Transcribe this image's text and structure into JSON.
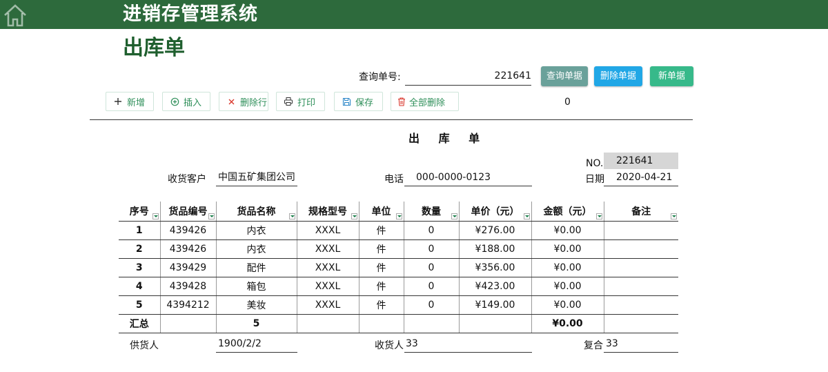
{
  "header": {
    "app_title": "进销存管理系统"
  },
  "page_title": "出库单",
  "query": {
    "label": "查询单号:",
    "value": "221641"
  },
  "actions": {
    "query": "查询单据",
    "delete_doc": "删除单据",
    "new_doc": "新单据"
  },
  "toolbar": {
    "add": "新增",
    "insert": "插入",
    "delete_row": "删除行",
    "print": "打印",
    "save": "保存",
    "delete_all": "全部删除",
    "counter": "0"
  },
  "form": {
    "title": "出 库 单",
    "no_label": "NO.",
    "no_value": "221641",
    "customer_label": "收货客户",
    "customer_value": "中国五矿集团公司",
    "phone_label": "电话",
    "phone_value": "000-0000-0123",
    "date_label": "日期",
    "date_value": "2020-04-21"
  },
  "table": {
    "headers": [
      "序号",
      "货品编号",
      "货品名称",
      "规格型号",
      "单位",
      "数量",
      "单价（元）",
      "金额（元）",
      "备注"
    ],
    "rows": [
      [
        "1",
        "439426",
        "内衣",
        "XXXL",
        "件",
        "0",
        "¥276.00",
        "¥0.00",
        ""
      ],
      [
        "2",
        "439426",
        "内衣",
        "XXXL",
        "件",
        "0",
        "¥188.00",
        "¥0.00",
        ""
      ],
      [
        "3",
        "439429",
        "配件",
        "XXXL",
        "件",
        "0",
        "¥356.00",
        "¥0.00",
        ""
      ],
      [
        "4",
        "439428",
        "箱包",
        "XXXL",
        "件",
        "0",
        "¥423.00",
        "¥0.00",
        ""
      ],
      [
        "5",
        "4394212",
        "美妆",
        "XXXL",
        "件",
        "0",
        "¥149.00",
        "¥0.00",
        ""
      ]
    ],
    "summary": {
      "label": "汇总",
      "name_count": "5",
      "total": "¥0.00"
    }
  },
  "footer": {
    "supplier_label": "供货人",
    "supplier_value": "1900/2/2",
    "receiver_label": "收货人",
    "receiver_value": "33",
    "reviewer_label": "复合",
    "reviewer_value": "33"
  },
  "colors": {
    "header_bg": "#2d6a3c",
    "title_green": "#1f5f2e",
    "query_btn": "#6aa19a",
    "delete_btn": "#21a7e6",
    "new_btn": "#37b98a",
    "no_bg": "#d6d6d6"
  },
  "icons": {
    "home": "home-icon",
    "add": "plus-icon",
    "insert": "circle-plus-icon",
    "delete_row": "x-icon",
    "print": "printer-icon",
    "save": "floppy-icon",
    "delete_all": "trash-icon"
  }
}
